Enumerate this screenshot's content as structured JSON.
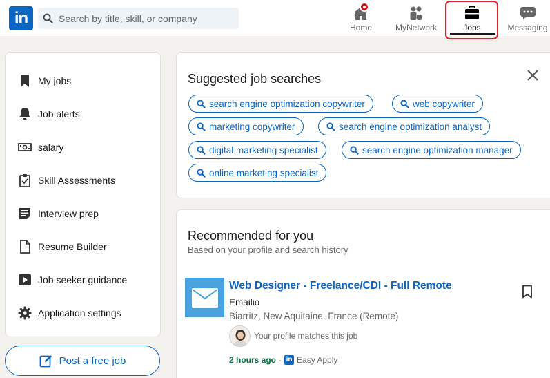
{
  "header": {
    "logo_text": "in",
    "search_placeholder": "Search by title, skill, or company",
    "nav": [
      {
        "label": "Home",
        "icon": "home-icon"
      },
      {
        "label": "MyNetwork",
        "icon": "people-icon"
      },
      {
        "label": "Jobs",
        "icon": "briefcase-icon"
      },
      {
        "label": "Messaging",
        "icon": "chat-icon"
      }
    ],
    "highlight_color": "#d9232d",
    "brand_color": "#0a66c2"
  },
  "sidebar": {
    "items": [
      {
        "label": "My jobs",
        "icon": "bookmark-icon"
      },
      {
        "label": "Job alerts",
        "icon": "bell-icon"
      },
      {
        "label": "salary",
        "icon": "money-icon"
      },
      {
        "label": "Skill Assessments",
        "icon": "clipboard-check-icon"
      },
      {
        "label": "Interview prep",
        "icon": "notes-icon"
      },
      {
        "label": "Resume Builder",
        "icon": "document-icon"
      },
      {
        "label": "Job seeker guidance",
        "icon": "video-icon"
      },
      {
        "label": "Application settings",
        "icon": "gear-icon"
      }
    ],
    "post_job_label": "Post a free job"
  },
  "suggested": {
    "title": "Suggested job searches",
    "pills": [
      "search engine optimization copywriter",
      "web copywriter",
      "marketing copywriter",
      "search engine optimization analyst",
      "digital marketing specialist",
      "search engine optimization manager",
      "online marketing specialist"
    ]
  },
  "recommended": {
    "title": "Recommended for you",
    "subtitle": "Based on your profile and search history",
    "job": {
      "title": "Web Designer - Freelance/CDI - Full Remote",
      "company": "Emailio",
      "location": "Biarritz, New Aquitaine, France (Remote)",
      "match_text": "Your profile matches this job",
      "posted": "2 hours ago",
      "separator": "·",
      "apply_logo": "in",
      "apply_text": "Easy Apply"
    }
  }
}
